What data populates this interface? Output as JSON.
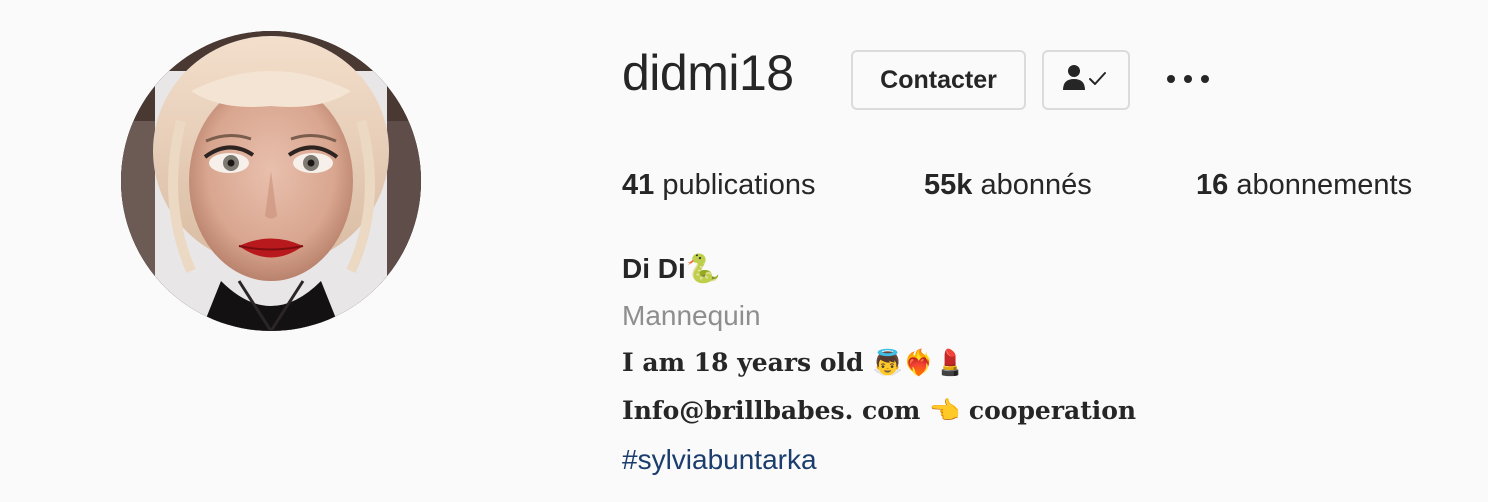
{
  "profile": {
    "username": "didmi18",
    "full_name": "Di Di🐍",
    "category": "Mannequin",
    "bio_lines": [
      "I am 18 years old 👼❤️‍🔥💄",
      "Info@brillbabes. com 👈 cooperation"
    ],
    "hashtag": "#sylviabuntarka"
  },
  "actions": {
    "contact_label": "Contacter",
    "follow_icon": "person-check-icon",
    "more_icon": "more-horizontal-icon"
  },
  "stats": {
    "posts_count": "41",
    "posts_label": "publications",
    "followers_count": "55k",
    "followers_label": "abonnés",
    "following_count": "16",
    "following_label": "abonnements"
  },
  "colors": {
    "background": "#fafafa",
    "text": "#262626",
    "secondary_text": "#8e8e8e",
    "border": "#dbdbdb",
    "hashtag": "#1a3d6e"
  }
}
